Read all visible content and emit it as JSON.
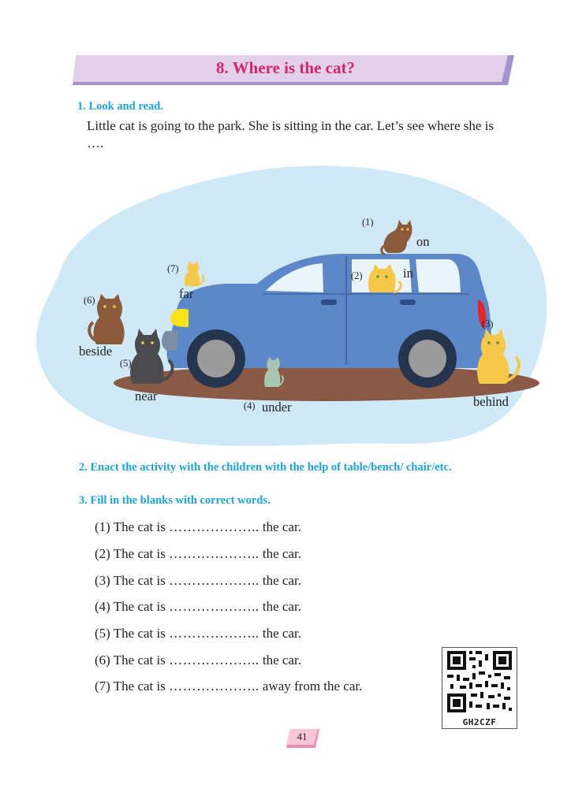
{
  "title": "8. Where is the cat?",
  "section1": {
    "heading": "1. Look and read.",
    "text": "Little cat is going to the park. She is sitting in the car. Let’s see where she is …."
  },
  "illustration": {
    "labels": {
      "on": "on",
      "in": "in",
      "far": "far",
      "beside": "beside",
      "near": "near",
      "under": "under",
      "behind": "behind"
    },
    "numbers": {
      "n1": "(1)",
      "n2": "(2)",
      "n3": "(3)",
      "n4": "(4)",
      "n5": "(5)",
      "n6": "(6)",
      "n7": "(7)"
    },
    "colors": {
      "blob": "#cfe9f7",
      "car": "#5c87c8",
      "ground": "#8b5a47",
      "brown_cat": "#8a5a3a",
      "ginger_cat": "#f6c84a",
      "grey_cat": "#4b4b4d"
    }
  },
  "section2": {
    "heading": "2. Enact the activity with the children with the help of table/bench/ chair/etc."
  },
  "section3": {
    "heading": "3. Fill in the blanks with correct words.",
    "items": [
      {
        "num": "(1)",
        "start": "The cat is",
        "dots": "………………..",
        "end": "the car."
      },
      {
        "num": "(2)",
        "start": "The cat is",
        "dots": "………………..",
        "end": "the car."
      },
      {
        "num": "(3)",
        "start": "The cat is",
        "dots": "………………..",
        "end": "the car."
      },
      {
        "num": "(4)",
        "start": "The cat is",
        "dots": "………………..",
        "end": "the car."
      },
      {
        "num": "(5)",
        "start": "The cat is",
        "dots": "………………..",
        "end": "the car."
      },
      {
        "num": "(6)",
        "start": "The cat is",
        "dots": "………………..",
        "end": "the car."
      },
      {
        "num": "(7)",
        "start": "The cat is",
        "dots": "………………..",
        "end": "away from the car."
      }
    ]
  },
  "qr": {
    "code": "GH2CZF"
  },
  "page_number": "41"
}
